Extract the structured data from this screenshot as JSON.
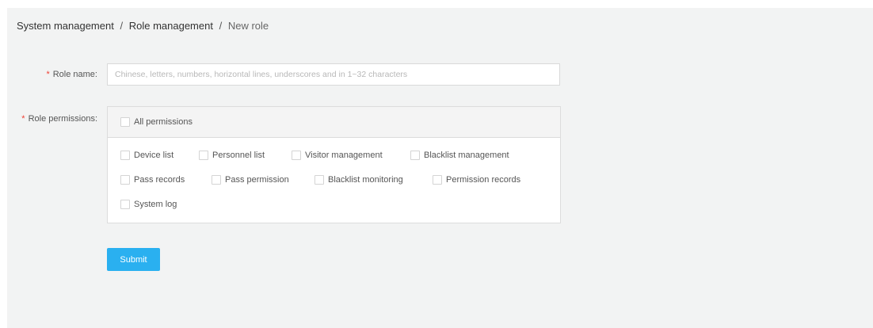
{
  "breadcrumb": {
    "items": [
      "System management",
      "Role management",
      "New role"
    ],
    "separator": "/"
  },
  "form": {
    "required_mark": "*",
    "role_name": {
      "label": "Role name:",
      "value": "",
      "placeholder": "Chinese, letters, numbers, horizontal lines, underscores and in 1~32 characters"
    },
    "role_permissions": {
      "label": "Role permissions:",
      "all_label": "All permissions",
      "all_checked": false,
      "options": [
        {
          "label": "Device list",
          "checked": false
        },
        {
          "label": "Personnel list",
          "checked": false
        },
        {
          "label": "Visitor management",
          "checked": false
        },
        {
          "label": "Blacklist management",
          "checked": false
        },
        {
          "label": "Pass records",
          "checked": false
        },
        {
          "label": "Pass permission",
          "checked": false
        },
        {
          "label": "Blacklist monitoring",
          "checked": false
        },
        {
          "label": "Permission records",
          "checked": false
        },
        {
          "label": "System log",
          "checked": false
        }
      ]
    },
    "submit_label": "Submit"
  },
  "colors": {
    "accent": "#2ab0f0",
    "required": "#f04134",
    "background": "#f2f3f3"
  }
}
